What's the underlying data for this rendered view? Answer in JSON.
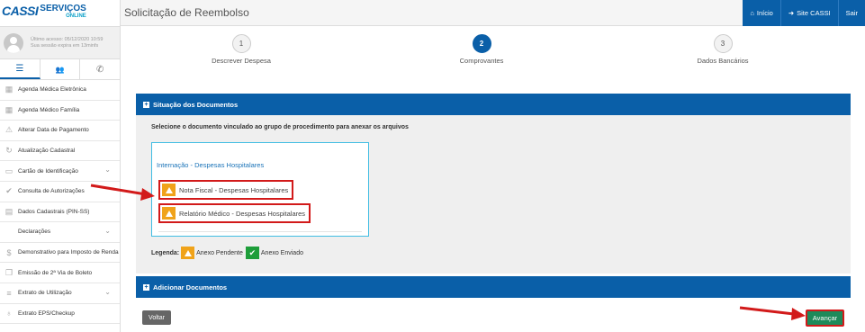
{
  "logo": {
    "brand": "CASSI",
    "line1": "SERVIÇOS",
    "line2": "ONLINE"
  },
  "profile": {
    "last_access": "Último acesso: 05/12/2020 10:59",
    "session": "Sua sessão expira em 13minfs"
  },
  "sidebar": {
    "tabs": [
      {
        "icon": "menu-icon",
        "glyph": "☰"
      },
      {
        "icon": "users-icon",
        "glyph": "👥"
      },
      {
        "icon": "phone-icon",
        "glyph": "✆"
      }
    ],
    "items": [
      {
        "label": "Agenda Médica Eletrônica",
        "icon": "calendar-icon",
        "glyph": "▦",
        "chevron": false
      },
      {
        "label": "Agenda Médico Família",
        "icon": "calendar-icon",
        "glyph": "▦",
        "chevron": false
      },
      {
        "label": "Alterar Data de Pagamento",
        "icon": "warning-icon",
        "glyph": "⚠",
        "chevron": false
      },
      {
        "label": "Atualização Cadastral",
        "icon": "refresh-icon",
        "glyph": "↻",
        "chevron": false
      },
      {
        "label": "Cartão de Identificação",
        "icon": "card-icon",
        "glyph": "▭",
        "chevron": true
      },
      {
        "label": "Consulta de Autorizações",
        "icon": "check-icon",
        "glyph": "✔",
        "chevron": false
      },
      {
        "label": "Dados Cadastrais (PIN-SS)",
        "icon": "table-icon",
        "glyph": "▤",
        "chevron": false
      },
      {
        "label": "Declarações",
        "icon": "",
        "glyph": "",
        "chevron": true
      },
      {
        "label": "Demonstrativo para Imposto de Renda",
        "icon": "dollar-icon",
        "glyph": "$",
        "chevron": false
      },
      {
        "label": "Emissão de 2ª Via de Boleto",
        "icon": "copy-icon",
        "glyph": "❐",
        "chevron": false
      },
      {
        "label": "Extrato de Utilização",
        "icon": "list-icon",
        "glyph": "≡",
        "chevron": true
      },
      {
        "label": "Extrato EPS/Checkup",
        "icon": "stethoscope-icon",
        "glyph": "♁",
        "chevron": false
      }
    ]
  },
  "header": {
    "title": "Solicitação de Reembolso",
    "nav": [
      {
        "label": "Início",
        "icon": "home-icon",
        "glyph": "⌂"
      },
      {
        "label": "Site CASSI",
        "icon": "share-icon",
        "glyph": "➜"
      },
      {
        "label": "Sair",
        "icon": "",
        "glyph": ""
      }
    ]
  },
  "stepper": {
    "steps": [
      {
        "number": "1",
        "label": "Descrever Despesa"
      },
      {
        "number": "2",
        "label": "Comprovantes"
      },
      {
        "number": "3",
        "label": "Dados Bancários"
      }
    ],
    "active_index": 1
  },
  "documents_panel": {
    "title": "Situação dos Documentos",
    "instruction": "Selecione o documento vinculado ao grupo de procedimento para anexar os arquivos",
    "group": "Internação - Despesas Hospitalares",
    "items": [
      {
        "label": "Nota Fiscal - Despesas Hospitalares",
        "status": "pending"
      },
      {
        "label": "Relatório Médico - Despesas Hospitalares",
        "status": "pending"
      }
    ],
    "legend": {
      "label": "Legenda:",
      "pending": "Anexo Pendente",
      "sent": "Anexo Enviado"
    }
  },
  "add_panel": {
    "title": "Adicionar Documentos"
  },
  "buttons": {
    "back": "Voltar",
    "next": "Avançar"
  },
  "colors": {
    "primary": "#0a5fa8",
    "pending": "#f0a31a",
    "sent": "#1e9e3a",
    "highlight": "#d21a1a",
    "next_button": "#1e8a5a"
  }
}
